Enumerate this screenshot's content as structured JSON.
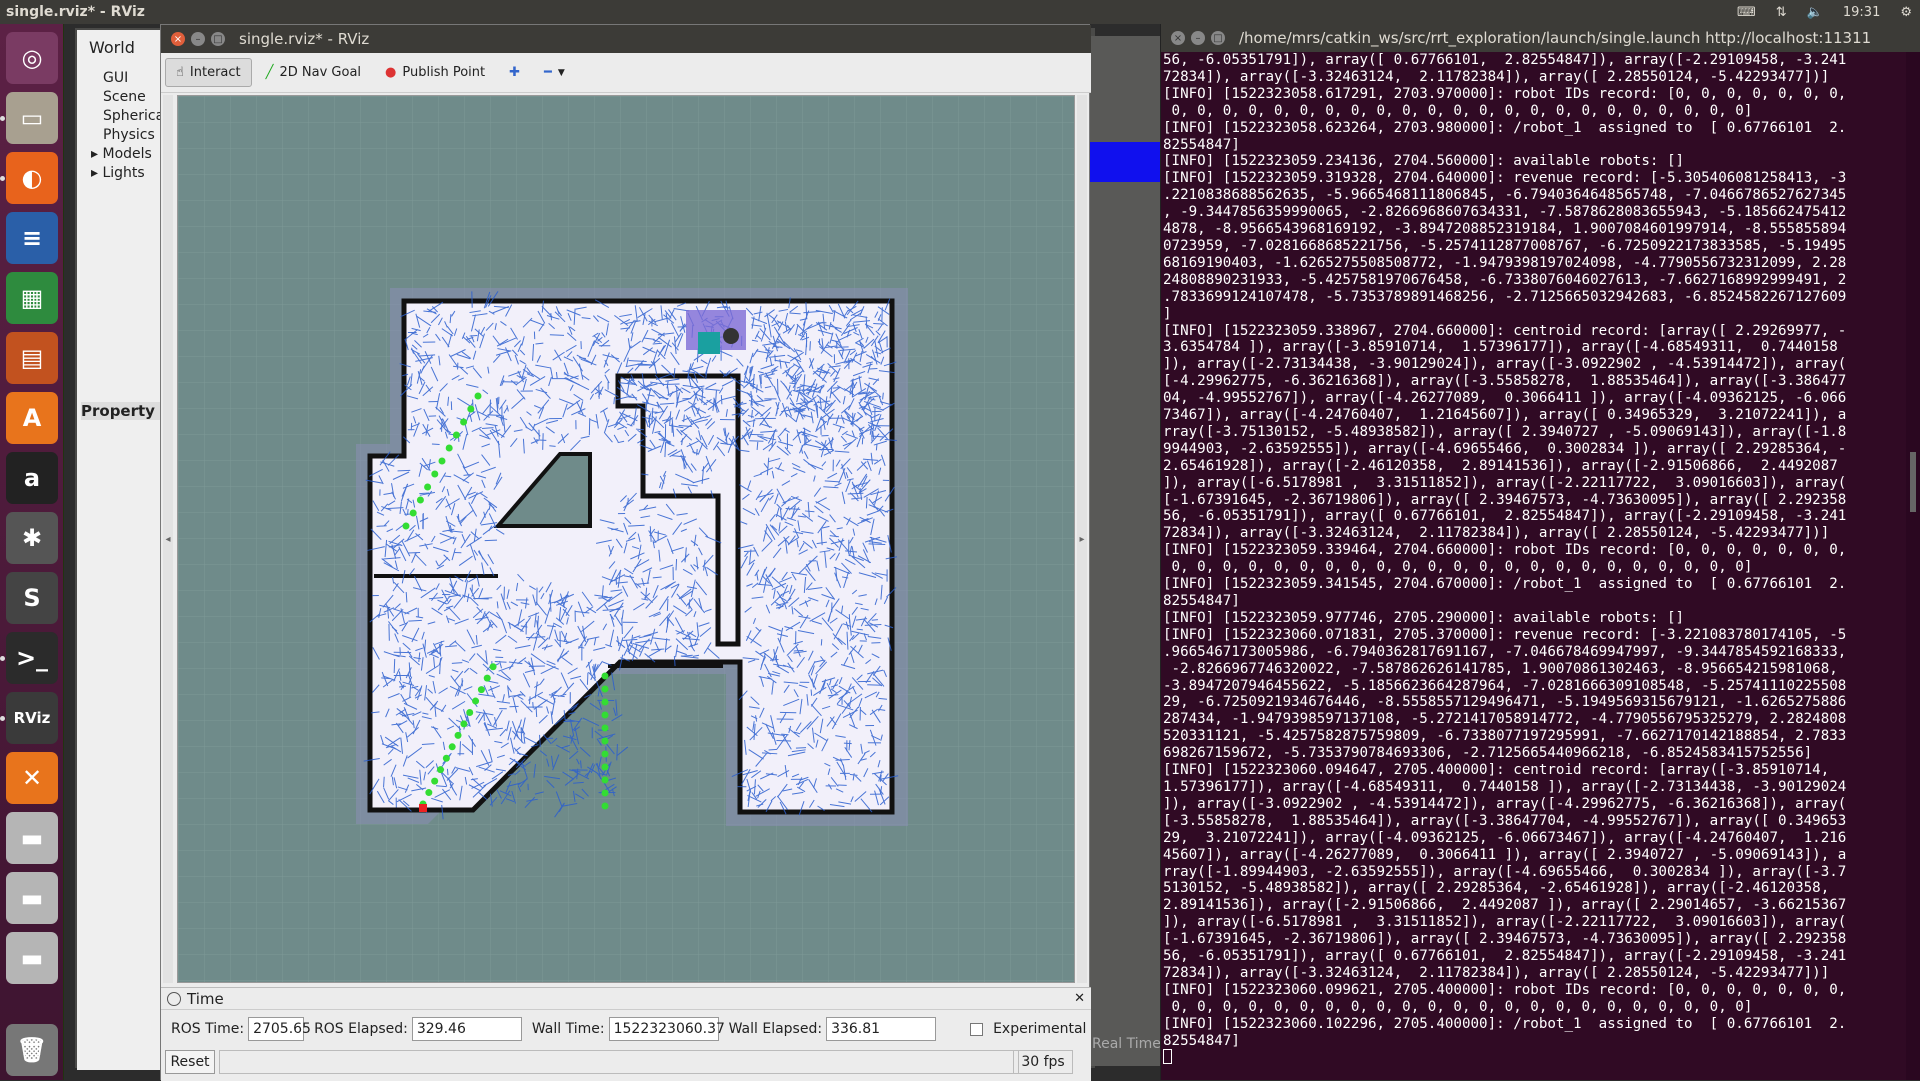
{
  "top_panel": {
    "title": "single.rviz* - RViz",
    "clock": "19:31"
  },
  "launcher": {
    "items": [
      {
        "name": "ubuntu-dash-icon",
        "glyph": "◎",
        "color": "#7a3b63"
      },
      {
        "name": "files-icon",
        "glyph": "▭",
        "color": "#a8a090"
      },
      {
        "name": "firefox-icon",
        "glyph": "◐",
        "color": "#e8631c"
      },
      {
        "name": "writer-icon",
        "glyph": "≡",
        "color": "#2a5fa8"
      },
      {
        "name": "calc-icon",
        "glyph": "▦",
        "color": "#2e8b3e"
      },
      {
        "name": "impress-icon",
        "glyph": "▤",
        "color": "#c2521f"
      },
      {
        "name": "software-center-icon",
        "glyph": "A",
        "color": "#e8741c"
      },
      {
        "name": "amazon-icon",
        "glyph": "a",
        "color": "#222222"
      },
      {
        "name": "settings-icon",
        "glyph": "✱",
        "color": "#555555"
      },
      {
        "name": "sublime-icon",
        "glyph": "S",
        "color": "#444444"
      },
      {
        "name": "terminal-icon",
        "glyph": ">_",
        "color": "#2b2b2b"
      },
      {
        "name": "rviz-icon",
        "glyph": "RViz",
        "color": "#3a3a3a"
      },
      {
        "name": "app-orange-icon",
        "glyph": "✕",
        "color": "#e8741c"
      },
      {
        "name": "drive-icon-1",
        "glyph": "▬",
        "color": "#b5b5b5"
      },
      {
        "name": "drive-icon-2",
        "glyph": "▬",
        "color": "#b5b5b5"
      },
      {
        "name": "drive-icon-3",
        "glyph": "▬",
        "color": "#b5b5b5"
      },
      {
        "name": "trash-icon",
        "glyph": "🗑",
        "color": "#777777"
      }
    ]
  },
  "displays_panel": {
    "world": "World",
    "items": [
      "GUI",
      "Scene",
      "Spherica",
      "Physics",
      "Models",
      "Lights"
    ],
    "property_label": "Property"
  },
  "bg_window": {
    "status_text": "Real Time"
  },
  "rviz": {
    "window_title": "single.rviz* - RViz",
    "toolbar": {
      "interact": "Interact",
      "nav_goal": "2D Nav Goal",
      "publish_point": "Publish Point"
    },
    "time_panel": {
      "header": "Time",
      "ros_time_label": "ROS Time:",
      "ros_time": "2705.65",
      "ros_elapsed_label": "ROS Elapsed:",
      "ros_elapsed": "329.46",
      "wall_time_label": "Wall Time:",
      "wall_time": "1522323060.37",
      "wall_elapsed_label": "Wall Elapsed:",
      "wall_elapsed": "336.81",
      "experimental_label": "Experimental",
      "reset": "Reset",
      "fps": "30 fps"
    },
    "colors": {
      "map_bg": "#6f8b8a",
      "free": "#f2f0fa",
      "wall": "#111111",
      "tree": "#2b5fcf",
      "frontier": "#33dd33"
    }
  },
  "terminal": {
    "title": "/home/mrs/catkin_ws/src/rrt_exploration/launch/single.launch http://localhost:11311",
    "lines": [
      "56, -6.05351791]), array([ 0.67766101,  2.82554847]), array([-2.29109458, -3.241",
      "72834]), array([-3.32463124,  2.11782384]), array([ 2.28550124, -5.42293477])]",
      "[INFO] [1522323058.617291, 2703.970000]: robot IDs record: [0, 0, 0, 0, 0, 0, 0,",
      " 0, 0, 0, 0, 0, 0, 0, 0, 0, 0, 0, 0, 0, 0, 0, 0, 0, 0, 0, 0, 0, 0, 0]",
      "[INFO] [1522323058.623264, 2703.980000]: /robot_1  assigned to  [ 0.67766101  2.",
      "82554847]",
      "[INFO] [1522323059.234136, 2704.560000]: available robots: []",
      "[INFO] [1522323059.319328, 2704.640000]: revenue record: [-5.305406081258413, -3",
      ".2210838688562635, -5.9665468111806845, -6.7940364648565748, -7.0466786527627345",
      ", -9.3447856359990065, -2.8266968607634331, -7.5878628083655943, -5.185662475412",
      "4878, -8.9566543968169192, -3.8947208852319184, 1.9007084601997914, -8.555855894",
      "0723959, -7.0281668685221756, -5.2574112877008767, -6.7250922173833585, -5.19495",
      "68169190403, -1.6265275508508772, -1.9479398197024098, -4.7790556732312099, 2.28",
      "24808890231933, -5.4257581970676458, -6.7338076046027613, -7.6627168992999491, 2",
      ".7833699124107478, -5.7353789891468256, -2.7125665032942683, -6.8524582267127609",
      "]",
      "[INFO] [1522323059.338967, 2704.660000]: centroid record: [array([ 2.29269977, -",
      "3.6354784 ]), array([-3.85910714,  1.57396177]), array([-4.68549311,  0.7440158",
      "]), array([-2.73134438, -3.90129024]), array([-3.0922902 , -4.53914472]), array(",
      "[-4.29962775, -6.36216368]), array([-3.55858278,  1.88535464]), array([-3.386477",
      "04, -4.99552767]), array([-4.26277089,  0.3066411 ]), array([-4.09362125, -6.066",
      "73467]), array([-4.24760407,  1.21645607]), array([ 0.34965329,  3.21072241]), a",
      "rray([-3.75130152, -5.48938582]), array([ 2.3940727 , -5.09069143]), array([-1.8",
      "9944903, -2.63592555]), array([-4.69655466,  0.3002834 ]), array([ 2.29285364, -",
      "2.65461928]), array([-2.46120358,  2.89141536]), array([-2.91506866,  2.4492087",
      "]), array([-6.5178981 ,  3.31511852]), array([-2.22117722,  3.09016603]), array(",
      "[-1.67391645, -2.36719806]), array([ 2.39467573, -4.73630095]), array([ 2.292358",
      "56, -6.05351791]), array([ 0.67766101,  2.82554847]), array([-2.29109458, -3.241",
      "72834]), array([-3.32463124,  2.11782384]), array([ 2.28550124, -5.42293477])]",
      "[INFO] [1522323059.339464, 2704.660000]: robot IDs record: [0, 0, 0, 0, 0, 0, 0,",
      " 0, 0, 0, 0, 0, 0, 0, 0, 0, 0, 0, 0, 0, 0, 0, 0, 0, 0, 0, 0, 0, 0, 0]",
      "[INFO] [1522323059.341545, 2704.670000]: /robot_1  assigned to  [ 0.67766101  2.",
      "82554847]",
      "[INFO] [1522323059.977746, 2705.290000]: available robots: []",
      "[INFO] [1522323060.071831, 2705.370000]: revenue record: [-3.221083780174105, -5",
      ".9665467173005986, -6.7940362817691167, -7.046678469947997, -9.3447854592168333,",
      " -2.8266967746320022, -7.587862626141785, 1.90070861302463, -8.956654215981068,",
      "-3.8947207946455622, -5.1856623664287964, -7.0281666309108548, -5.25741110225508",
      "29, -6.7250921934676446, -8.5558557129496471, -5.1949569315679121, -1.6265275886",
      "287434, -1.9479398597137108, -5.2721417058914772, -4.7790556795325279, 2.2824808",
      "520331121, -5.4257582875759809, -6.7338077197295991, -7.6627170142188854, 2.7833",
      "698267159672, -5.7353790784693306, -2.7125665440966218, -6.8524583415752556]",
      "[INFO] [1522323060.094647, 2705.400000]: centroid record: [array([-3.85910714,",
      "1.57396177]), array([-4.68549311,  0.7440158 ]), array([-2.73134438, -3.90129024",
      "]), array([-3.0922902 , -4.53914472]), array([-4.29962775, -6.36216368]), array(",
      "[-3.55858278,  1.88535464]), array([-3.38647704, -4.99552767]), array([ 0.349653",
      "29,  3.21072241]), array([-4.09362125, -6.06673467]), array([-4.24760407,  1.216",
      "45607]), array([-4.26277089,  0.3066411 ]), array([ 2.3940727 , -5.09069143]), a",
      "rray([-1.89944903, -2.63592555]), array([-4.69655466,  0.3002834 ]), array([-3.7",
      "5130152, -5.48938582]), array([ 2.29285364, -2.65461928]), array([-2.46120358,",
      "2.89141536]), array([-2.91506866,  2.4492087 ]), array([ 2.29014657, -3.66215367",
      "]), array([-6.5178981 ,  3.31511852]), array([-2.22117722,  3.09016603]), array(",
      "[-1.67391645, -2.36719806]), array([ 2.39467573, -4.73630095]), array([ 2.292358",
      "56, -6.05351791]), array([ 0.67766101,  2.82554847]), array([-2.29109458, -3.241",
      "72834]), array([-3.32463124,  2.11782384]), array([ 2.28550124, -5.42293477])]",
      "[INFO] [1522323060.099621, 2705.400000]: robot IDs record: [0, 0, 0, 0, 0, 0, 0,",
      " 0, 0, 0, 0, 0, 0, 0, 0, 0, 0, 0, 0, 0, 0, 0, 0, 0, 0, 0, 0, 0, 0, 0]",
      "[INFO] [1522323060.102296, 2705.400000]: /robot_1  assigned to  [ 0.67766101  2.",
      "82554847]"
    ]
  }
}
